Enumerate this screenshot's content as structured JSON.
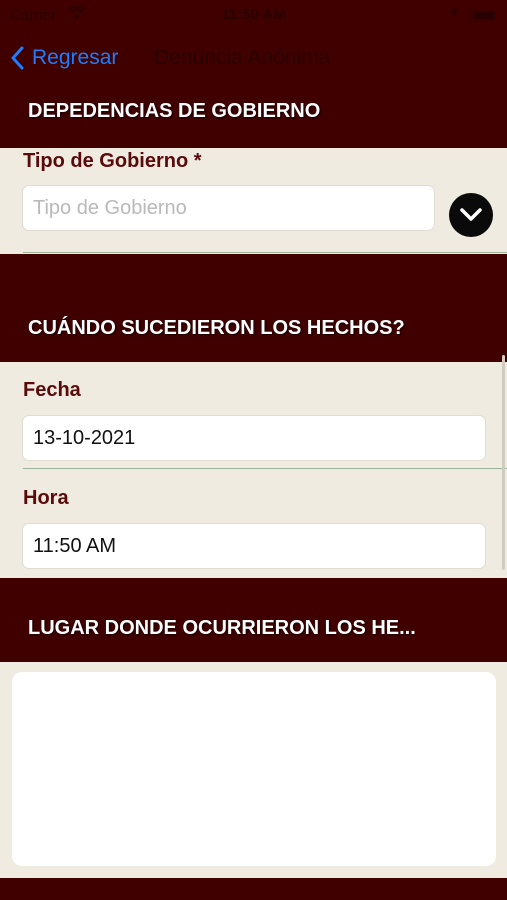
{
  "status_bar": {
    "carrier": "Carrier",
    "time": "11:50 AM"
  },
  "nav": {
    "back_label": "Regresar",
    "title": "Denuncia Anónima"
  },
  "sections": {
    "government": {
      "header": "DEPEDENCIAS DE GOBIERNO",
      "field_label": "Tipo de Gobierno *",
      "field_placeholder": "Tipo de Gobierno"
    },
    "when": {
      "header": "CUÁNDO SUCEDIERON LOS HECHOS?",
      "date_label": "Fecha",
      "date_value": "13-10-2021",
      "time_label": "Hora",
      "time_value": "11:50 AM"
    },
    "where": {
      "header": "LUGAR DONDE OCURRIERON LOS HE..."
    }
  },
  "colors": {
    "header_bg": "#400000",
    "panel_bg": "#efebe0",
    "accent": "#1e7cff",
    "label": "#5a0a0a"
  }
}
